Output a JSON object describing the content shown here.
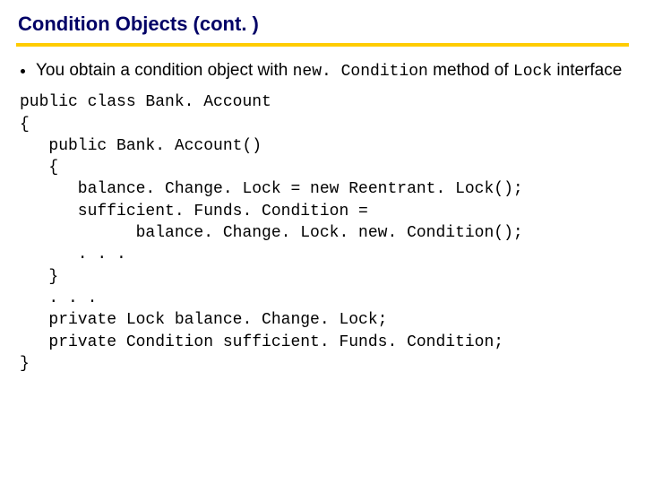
{
  "title": "Condition Objects  (cont. )",
  "bullet": {
    "pre": "You obtain a condition object with ",
    "code1": "new. Condition",
    "mid": " method of ",
    "code2": "Lock",
    "post": " interface"
  },
  "code": "public class Bank. Account\n{\n   public Bank. Account()\n   {\n      balance. Change. Lock = new Reentrant. Lock();\n      sufficient. Funds. Condition =\n            balance. Change. Lock. new. Condition();\n      . . .\n   }\n   . . .\n   private Lock balance. Change. Lock;\n   private Condition sufficient. Funds. Condition;\n}"
}
